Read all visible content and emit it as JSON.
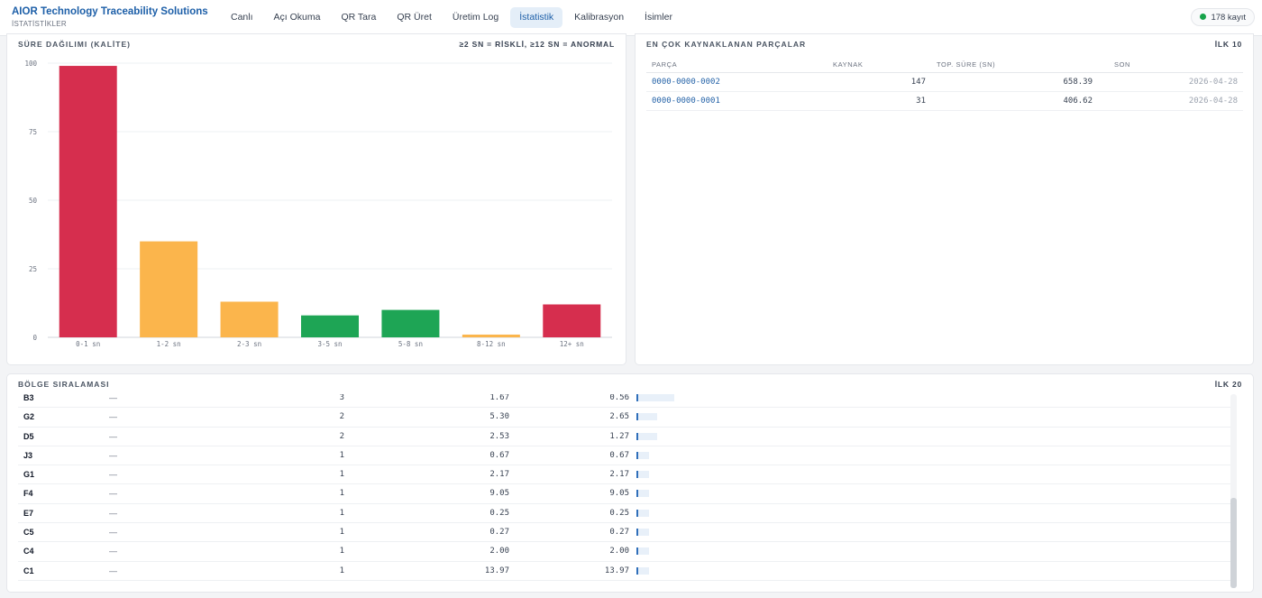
{
  "app": {
    "title": "AIOR Technology Traceability Solutions",
    "subtitle": "İSTATİSTİKLER"
  },
  "nav": {
    "tabs": [
      {
        "label": "Canlı"
      },
      {
        "label": "Açı Okuma"
      },
      {
        "label": "QR Tara"
      },
      {
        "label": "QR Üret"
      },
      {
        "label": "Üretim Log"
      },
      {
        "label": "İstatistik",
        "active": true
      },
      {
        "label": "Kalibrasyon"
      },
      {
        "label": "İsimler"
      }
    ]
  },
  "status_badge": {
    "label": "178 kayıt",
    "color": "#16a34a"
  },
  "chart_panel": {
    "title": "SÜRE DAĞILIMI (KALİTE)",
    "legend_note": "≥2 SN = RİSKLİ, ≥12 SN = ANORMAL"
  },
  "chart_data": {
    "type": "bar",
    "categories": [
      "0-1 sn",
      "1-2 sn",
      "2-3 sn",
      "3-5 sn",
      "5-8 sn",
      "8-12 sn",
      "12+ sn"
    ],
    "values": [
      99,
      35,
      13,
      8,
      10,
      1,
      12
    ],
    "colors": [
      "#d62e4e",
      "#fbb54c",
      "#fbb54c",
      "#1ea555",
      "#1ea555",
      "#fbb54c",
      "#d62e4e"
    ],
    "ylim": [
      0,
      100
    ],
    "yticks": [
      "0",
      "25",
      "50",
      "75",
      "100"
    ],
    "title": "",
    "xlabel": "",
    "ylabel": "",
    "grid": true
  },
  "parts_panel": {
    "title": "EN ÇOK KAYNAKLANAN PARÇALAR",
    "limit_label": "İLK 10",
    "headers": {
      "part": "PARÇA",
      "count": "KAYNAK",
      "total": "TOP. SÜRE (SN)",
      "last": "SON"
    },
    "rows": [
      {
        "part": "0000-0000-0002",
        "count": "147",
        "total": "658.39",
        "last": "2026-04-28"
      },
      {
        "part": "0000-0000-0001",
        "count": "31",
        "total": "406.62",
        "last": "2026-04-28"
      }
    ]
  },
  "region_panel": {
    "title": "BÖLGE SIRALAMASI",
    "limit_label": "İLK 20",
    "rows": [
      {
        "name": "B3",
        "label": "—",
        "count": "3",
        "total": "1.67",
        "avg": "0.56",
        "level": 0.56
      },
      {
        "name": "G2",
        "label": "—",
        "count": "2",
        "total": "5.30",
        "avg": "2.65",
        "level": 0.3
      },
      {
        "name": "D5",
        "label": "—",
        "count": "2",
        "total": "2.53",
        "avg": "1.27",
        "level": 0.3
      },
      {
        "name": "J3",
        "label": "—",
        "count": "1",
        "total": "0.67",
        "avg": "0.67",
        "level": 0.15
      },
      {
        "name": "G1",
        "label": "—",
        "count": "1",
        "total": "2.17",
        "avg": "2.17",
        "level": 0.15
      },
      {
        "name": "F4",
        "label": "—",
        "count": "1",
        "total": "9.05",
        "avg": "9.05",
        "level": 0.15
      },
      {
        "name": "E7",
        "label": "—",
        "count": "1",
        "total": "0.25",
        "avg": "0.25",
        "level": 0.15
      },
      {
        "name": "C5",
        "label": "—",
        "count": "1",
        "total": "0.27",
        "avg": "0.27",
        "level": 0.15
      },
      {
        "name": "C4",
        "label": "—",
        "count": "1",
        "total": "2.00",
        "avg": "2.00",
        "level": 0.15
      },
      {
        "name": "C1",
        "label": "—",
        "count": "1",
        "total": "13.97",
        "avg": "13.97",
        "level": 0.15
      }
    ]
  }
}
